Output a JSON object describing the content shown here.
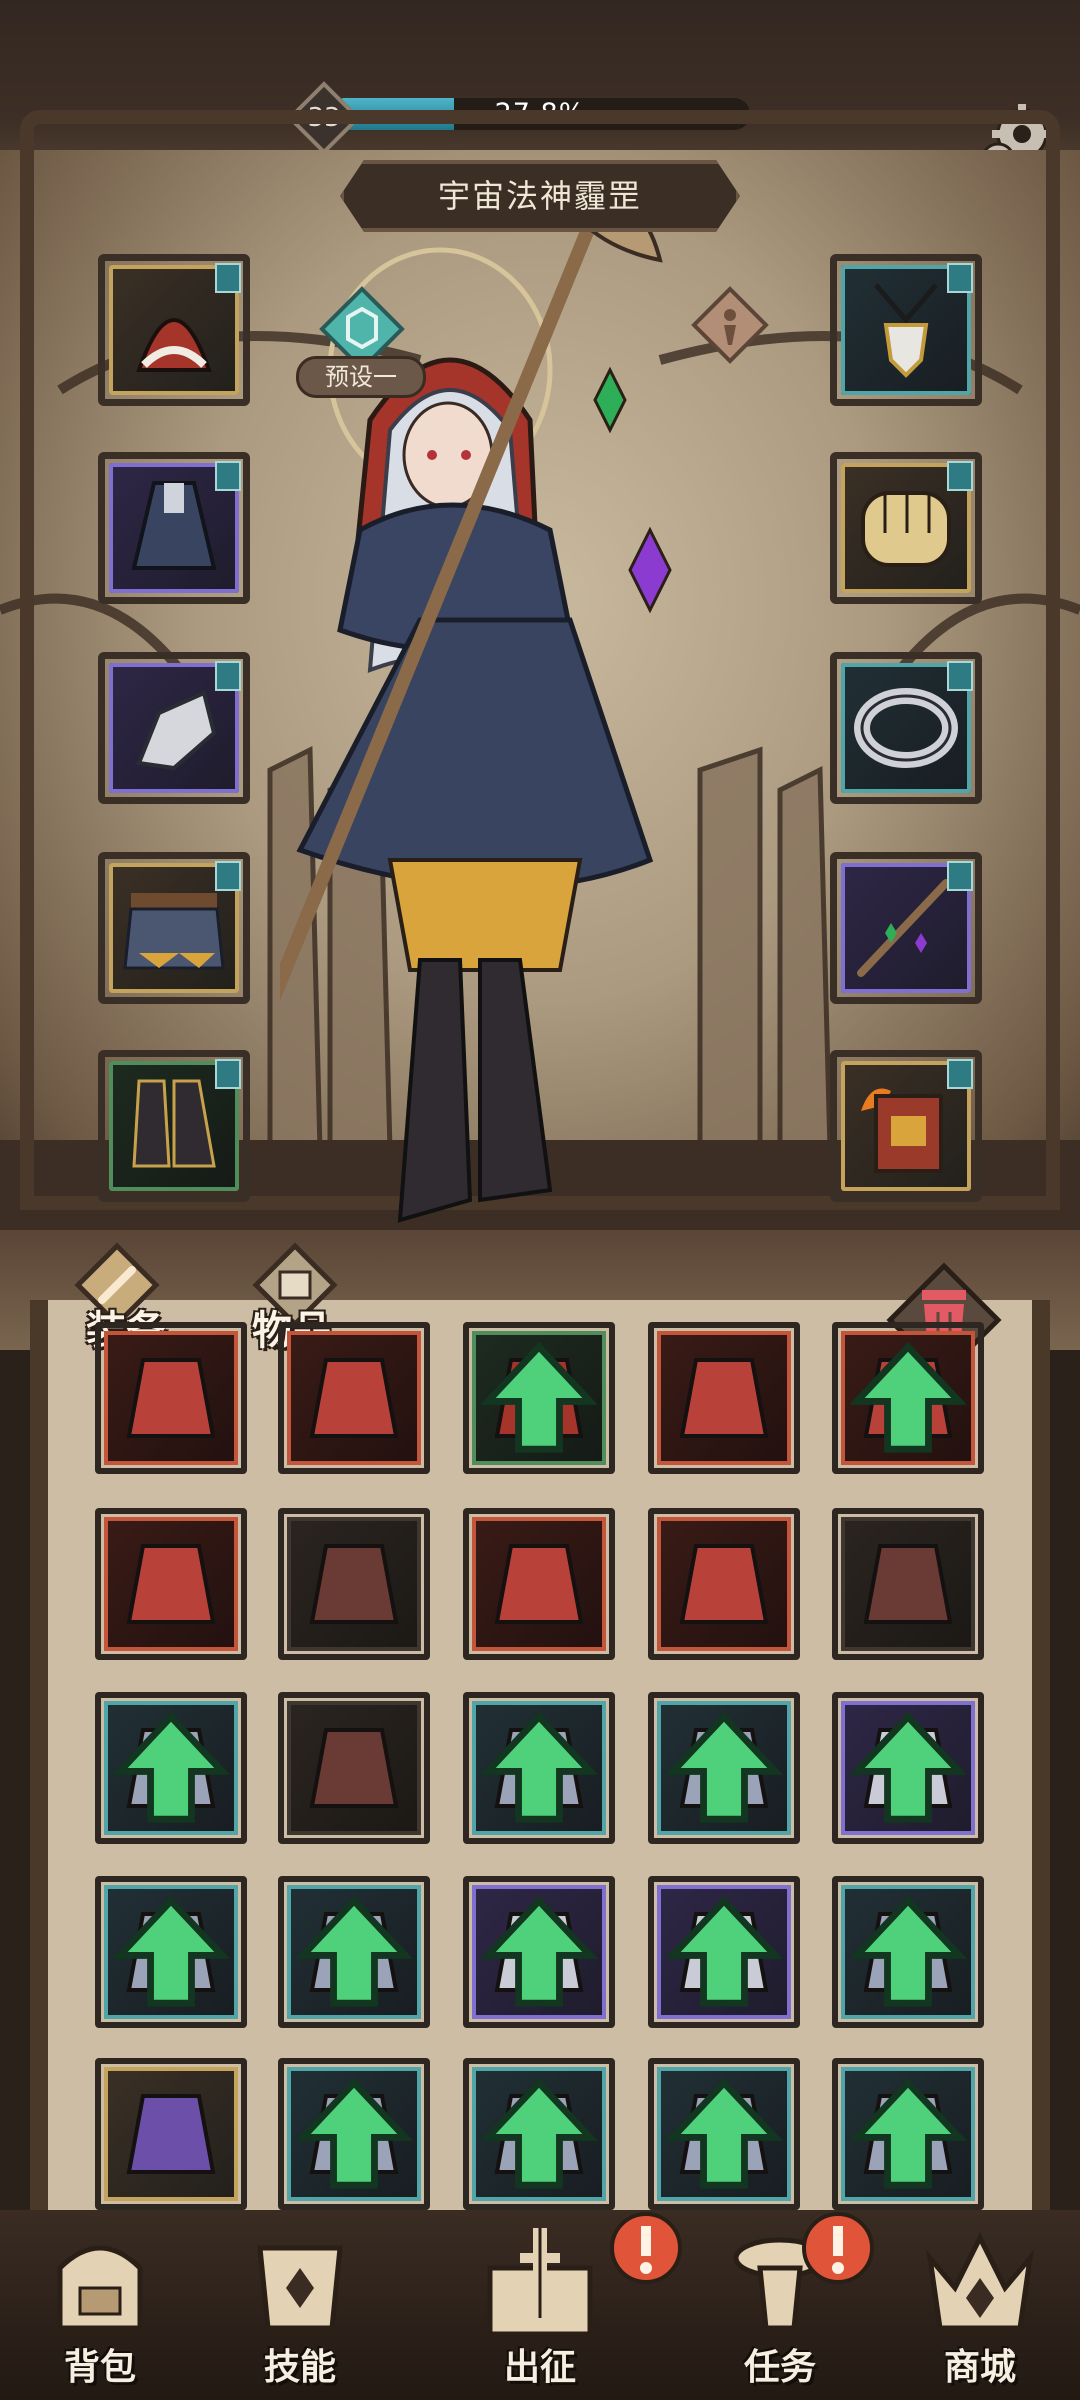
{
  "status_bar": {
    "level": "33",
    "progress_text": "27.8%",
    "progress_fraction": 0.278,
    "settings_icon": "gear-icon"
  },
  "character": {
    "name": "宇宙法神霾罡",
    "preset_label": "预设一"
  },
  "equipment_left": [
    {
      "item": "red-hood",
      "rarity": "gold"
    },
    {
      "item": "dark-dress",
      "rarity": "purple"
    },
    {
      "item": "steel-gauntlet",
      "rarity": "purple"
    },
    {
      "item": "belted-skirt",
      "rarity": "gold"
    },
    {
      "item": "black-boots",
      "rarity": "green"
    }
  ],
  "equipment_right": [
    {
      "item": "pendant-amulet",
      "rarity": "teal"
    },
    {
      "item": "golden-fist",
      "rarity": "gold"
    },
    {
      "item": "silver-ring",
      "rarity": "teal"
    },
    {
      "item": "wooden-staff",
      "rarity": "purple"
    },
    {
      "item": "flaming-tome",
      "rarity": "gold"
    }
  ],
  "inventory": {
    "tabs": [
      "装备",
      "物品"
    ],
    "trash_icon": "trash-icon",
    "slots": [
      {
        "item": "red-sword",
        "rarity": "red",
        "upgrade": false
      },
      {
        "item": "thorn-hood",
        "rarity": "red",
        "upgrade": false
      },
      {
        "item": "red-hood",
        "rarity": "green",
        "upgrade": true
      },
      {
        "item": "red-gauntlet",
        "rarity": "red",
        "upgrade": false
      },
      {
        "item": "orange-fist",
        "rarity": "red",
        "upgrade": true
      },
      {
        "item": "fire-staff",
        "rarity": "red",
        "upgrade": false
      },
      {
        "item": "iron-helm",
        "rarity": "dark",
        "upgrade": false
      },
      {
        "item": "fire-staff",
        "rarity": "red",
        "upgrade": false
      },
      {
        "item": "red-helm",
        "rarity": "red",
        "upgrade": false
      },
      {
        "item": "red-glove",
        "rarity": "dark",
        "upgrade": false
      },
      {
        "item": "dark-pendant",
        "rarity": "teal",
        "upgrade": true
      },
      {
        "item": "red-dagger",
        "rarity": "dark",
        "upgrade": false
      },
      {
        "item": "wooden-staff",
        "rarity": "teal",
        "upgrade": true
      },
      {
        "item": "white-pants",
        "rarity": "teal",
        "upgrade": true
      },
      {
        "item": "white-jacket",
        "rarity": "purple",
        "upgrade": true
      },
      {
        "item": "black-boots",
        "rarity": "teal",
        "upgrade": true
      },
      {
        "item": "witch-hat",
        "rarity": "teal",
        "upgrade": true
      },
      {
        "item": "iron-scepter",
        "rarity": "purple",
        "upgrade": true
      },
      {
        "item": "corset-dress",
        "rarity": "purple",
        "upgrade": true
      },
      {
        "item": "navy-coat",
        "rarity": "teal",
        "upgrade": true
      },
      {
        "item": "jeweled-tome",
        "rarity": "gold",
        "upgrade": false
      },
      {
        "item": "red-vest",
        "rarity": "teal",
        "upgrade": true
      },
      {
        "item": "dark-dress",
        "rarity": "teal",
        "upgrade": true
      },
      {
        "item": "black-boots",
        "rarity": "teal",
        "upgrade": true
      },
      {
        "item": "belted-skirt",
        "rarity": "teal",
        "upgrade": true
      }
    ]
  },
  "bottom_nav": [
    {
      "label": "背包",
      "icon": "backpack-icon",
      "alert": false
    },
    {
      "label": "技能",
      "icon": "skill-scroll-icon",
      "alert": false
    },
    {
      "label": "出征",
      "icon": "sword-map-icon",
      "alert": true
    },
    {
      "label": "任务",
      "icon": "quest-scroll-icon",
      "alert": true
    },
    {
      "label": "商城",
      "icon": "shop-crown-icon",
      "alert": false
    }
  ],
  "colors": {
    "progress_fill": "#2f9bb1",
    "gold_rarity": "#c4a45c",
    "purple_rarity": "#7f6fd0",
    "teal_rarity": "#4fa5a8",
    "red_rarity": "#c4543a",
    "upgrade_arrow": "#4fd07a",
    "alert": "#e0553a"
  }
}
